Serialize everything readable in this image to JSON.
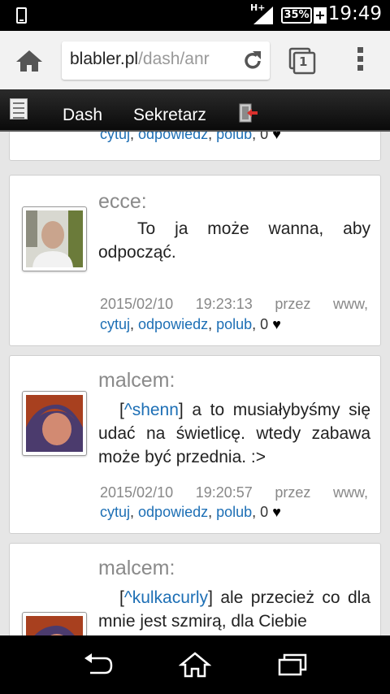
{
  "status": {
    "network": "H+",
    "battery": "35%",
    "time": "19:49"
  },
  "browser": {
    "url_host": "blabler.pl",
    "url_path": "/dash/anr",
    "tabs_count": "1"
  },
  "sitenav": {
    "dash": "Dash",
    "sekretarz": "Sekretarz"
  },
  "actions": {
    "cytuj": "cytuj",
    "odpowiedz": "odpowiedz",
    "polub": "polub",
    "likes": "0",
    "heart": "♥",
    "sep": ", "
  },
  "posts": [
    {
      "author": "ecce:",
      "text": "To ja może wanna, aby odpocząć.",
      "date": "2015/02/10",
      "time": "19:23:13",
      "via": "przez",
      "source": "www,"
    },
    {
      "author": "malcem:",
      "mention": "^shenn",
      "text": " a to musiałybyśmy się udać na świetlicę. wtedy zabawa może być przednia. :>",
      "date": "2015/02/10",
      "time": "19:20:57",
      "via": "przez",
      "source": "www,"
    },
    {
      "author": "malcem:",
      "mention": "^kulkacurly",
      "text": " ale przecież co dla mnie jest szmirą, dla Ciebie"
    }
  ]
}
